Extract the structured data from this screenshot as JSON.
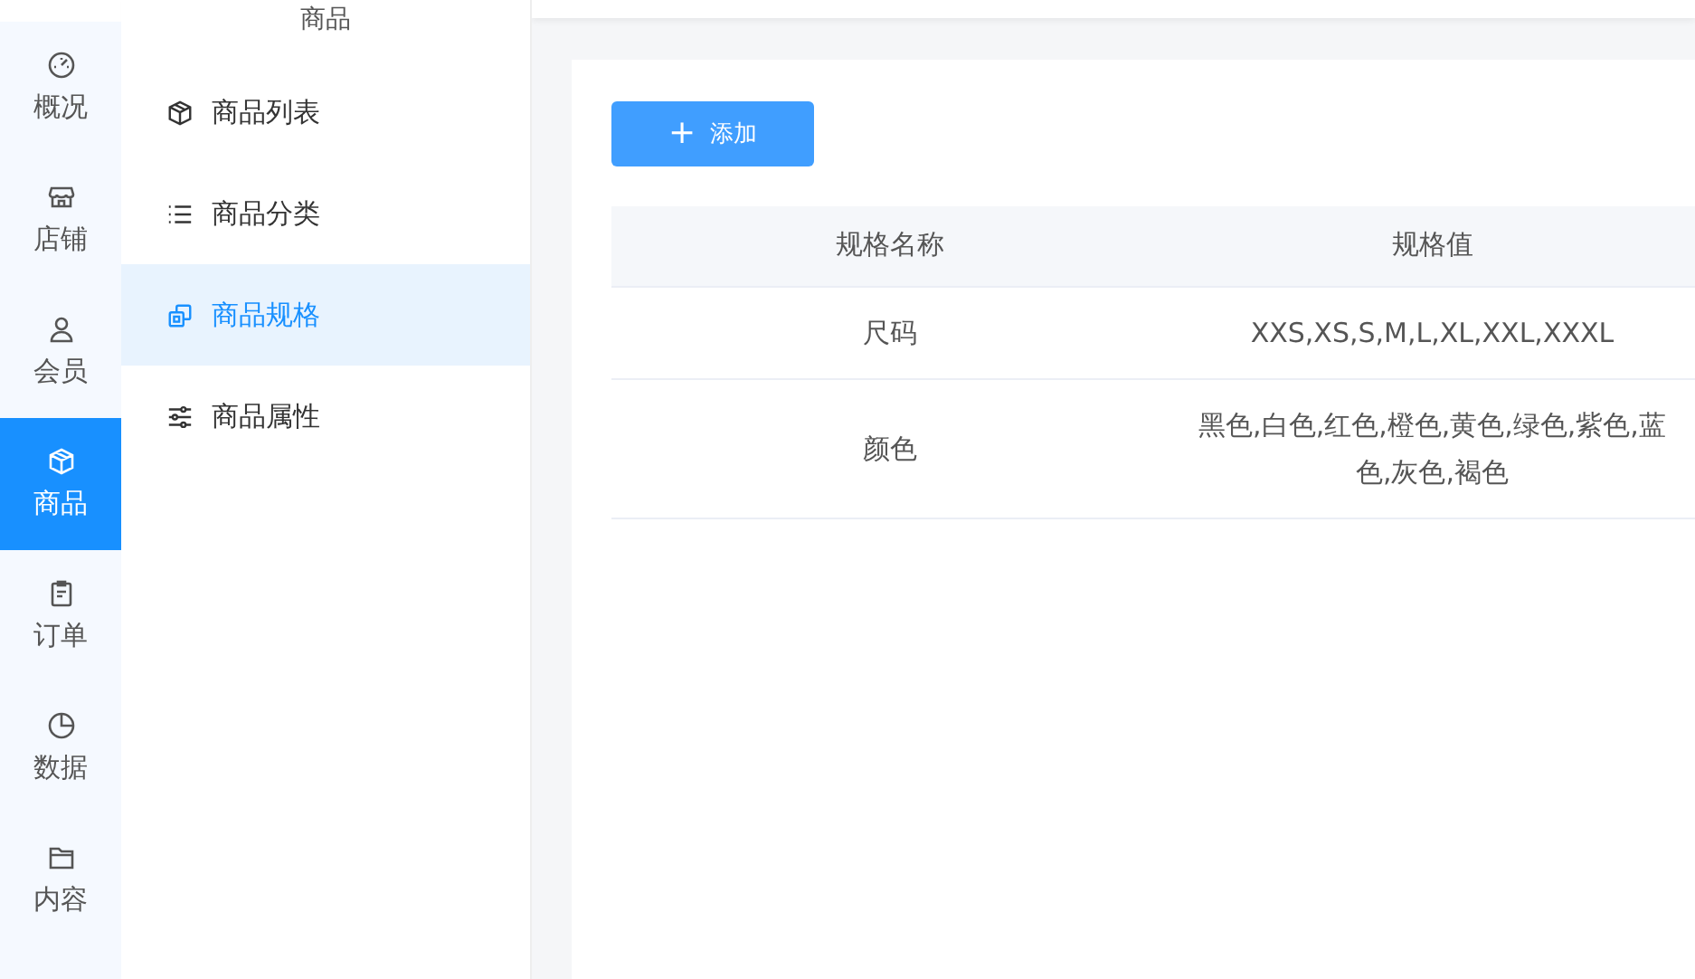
{
  "rail": {
    "items": [
      {
        "label": "概况",
        "selected": false
      },
      {
        "label": "店铺",
        "selected": false
      },
      {
        "label": "会员",
        "selected": false
      },
      {
        "label": "商品",
        "selected": true
      },
      {
        "label": "订单",
        "selected": false
      },
      {
        "label": "数据",
        "selected": false
      },
      {
        "label": "内容",
        "selected": false
      }
    ]
  },
  "submenu": {
    "title": "商品",
    "items": [
      {
        "label": "商品列表",
        "selected": false
      },
      {
        "label": "商品分类",
        "selected": false
      },
      {
        "label": "商品规格",
        "selected": true
      },
      {
        "label": "商品属性",
        "selected": false
      }
    ]
  },
  "add_button": {
    "icon": "+",
    "label": "添加"
  },
  "table": {
    "columns": [
      "规格名称",
      "规格值"
    ],
    "rows": [
      [
        "尺码",
        "XXS,XS,S,M,L,XL,XXL,XXXL"
      ],
      [
        "颜色",
        "黑色,白色,红色,橙色,黄色,绿色,紫色,蓝色,灰色,褐色"
      ]
    ]
  }
}
